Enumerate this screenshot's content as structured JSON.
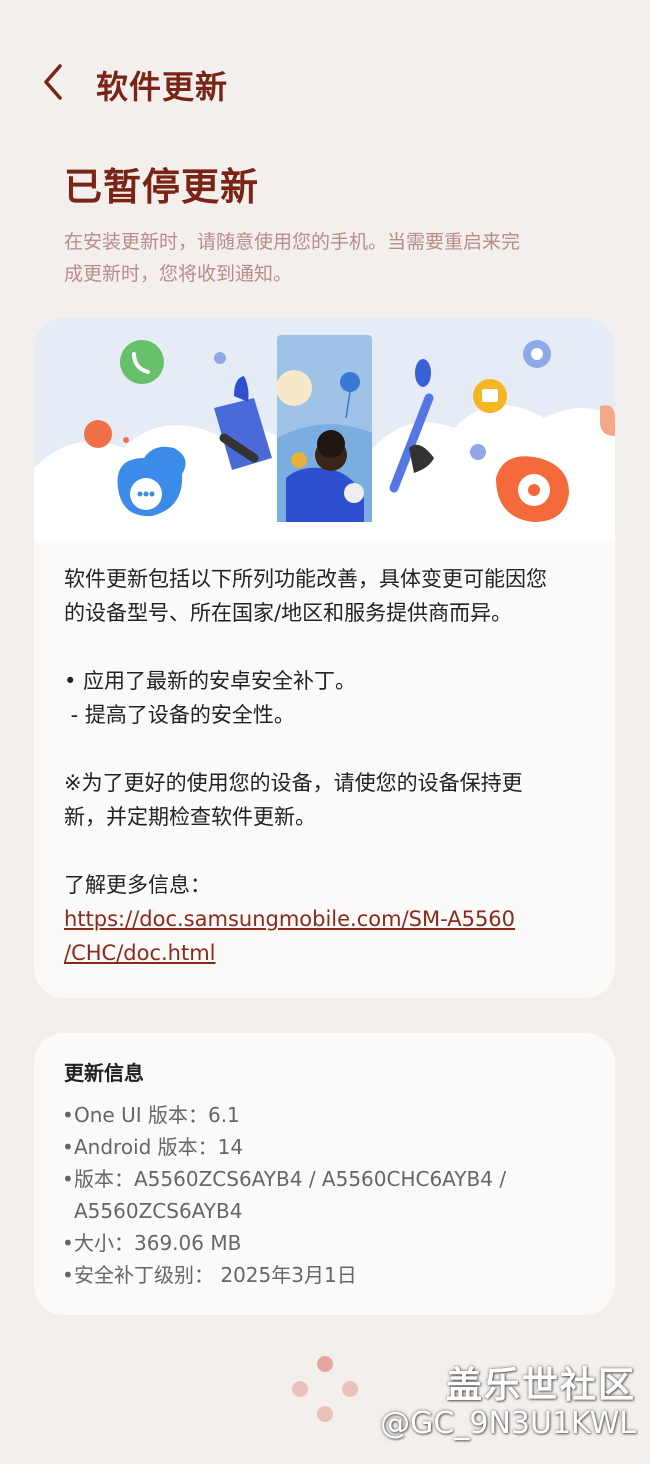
{
  "header": {
    "back_icon": "chevron-left-icon",
    "title": "软件更新"
  },
  "status": {
    "title": "已暂停更新",
    "description_lines": [
      "在安装更新时，请随意使用您的手机。当需要重启来完",
      "成更新时，您将收到通知。"
    ]
  },
  "main_card": {
    "intro_lines": [
      "软件更新包括以下所列功能改善，具体变更可能因您",
      "的设备型号、所在国家/地区和服务提供商而异。"
    ],
    "bullets": [
      "• 应用了最新的安卓安全补丁。",
      " - 提高了设备的安全性。"
    ],
    "note_lines": [
      "※为了更好的使用您的设备，请使您的设备保持更",
      "新，并定期检查软件更新。"
    ],
    "more_info_label": "了解更多信息：",
    "link_lines": [
      "https://doc.samsungmobile.com/SM-A5560",
      "/CHC/doc.html"
    ]
  },
  "info_card": {
    "title": "更新信息",
    "items": [
      "One UI 版本：6.1",
      "Android 版本：14",
      "版本：A5560ZCS6AYB4 / A5560CHC6AYB4 /",
      "A5560ZCS6AYB4",
      "大小：369.06 MB",
      "安全补丁级别： 2025年3月1日"
    ]
  },
  "watermark": {
    "line1": "盖乐世社区",
    "line2": "@GC_9N3U1KWL"
  },
  "colors": {
    "accent": "#7a2416",
    "link": "#8b2a1a",
    "muted": "#b98d86",
    "background": "#f3efed",
    "card": "#fbfaf9"
  }
}
